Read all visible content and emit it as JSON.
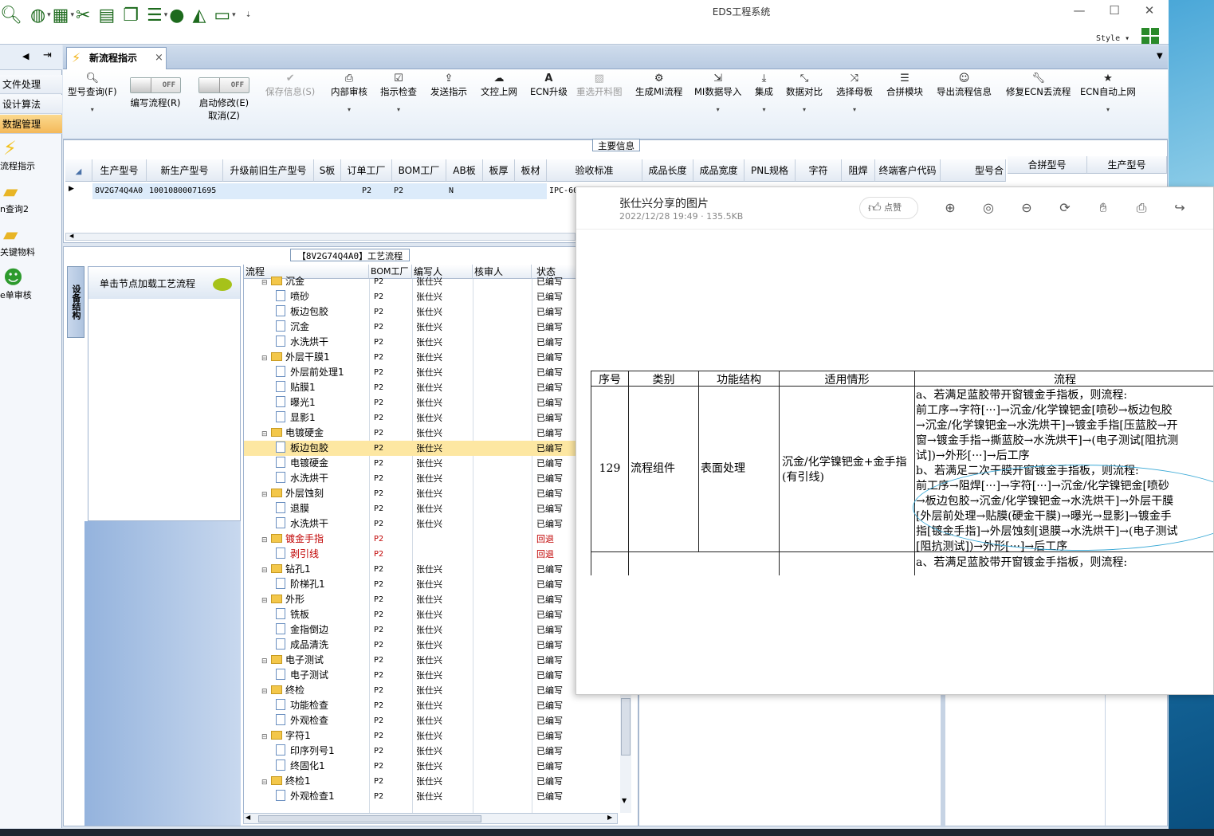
{
  "window": {
    "title": "EDS工程系统",
    "style_label": "Style",
    "controls": [
      "—",
      "☐",
      "✕"
    ]
  },
  "sidebar": {
    "items": [
      {
        "label": "文件处理"
      },
      {
        "label": "设计算法"
      },
      {
        "label": "数据管理"
      }
    ],
    "big_items": [
      {
        "label": "流程指示"
      },
      {
        "label": "n查询2"
      },
      {
        "label": "关键物料"
      },
      {
        "label": "e单审核"
      }
    ]
  },
  "tabs": {
    "active": "新流程指示",
    "close": "×"
  },
  "toolbar": {
    "items": [
      {
        "label": "型号查询(F)",
        "icon": "search-icon"
      },
      {
        "label": "编写流程(R)",
        "toggle": "OFF"
      },
      {
        "label": "启动修改(E)",
        "label2": "取消(Z)",
        "toggle": "OFF"
      },
      {
        "label": "保存信息(S)",
        "icon": "check-icon"
      },
      {
        "label": "内部审核",
        "icon": "printer-icon"
      },
      {
        "label": "指示检查",
        "icon": "checkbox-icon"
      },
      {
        "label": "发送指示",
        "icon": "upload-icon"
      },
      {
        "label": "文控上网",
        "icon": "cloud-icon"
      },
      {
        "label": "ECN升级",
        "icon": "font-icon"
      },
      {
        "label": "重选开料图",
        "icon": "image-icon"
      },
      {
        "label": "生成MI流程",
        "icon": "gears-icon"
      },
      {
        "label": "MI数据导入",
        "icon": "import-icon"
      },
      {
        "label": "集成",
        "icon": "download-icon"
      },
      {
        "label": "数据对比",
        "icon": "compress-icon"
      },
      {
        "label": "选择母板",
        "icon": "shuffle-icon"
      },
      {
        "label": "合拼模块",
        "icon": "list-icon"
      },
      {
        "label": "导出流程信息",
        "icon": "smile-icon"
      },
      {
        "label": "修复ECN丢流程",
        "icon": "wrench-icon"
      },
      {
        "label": "ECN自动上网",
        "icon": "star-icon"
      }
    ]
  },
  "main_info": {
    "title": "主要信息",
    "columns": [
      "生产型号",
      "新生产型号",
      "升级前旧生产型号",
      "S板",
      "订单工厂",
      "BOM工厂",
      "AB板",
      "板厚",
      "板材",
      "验收标准",
      "成品长度",
      "成品宽度",
      "PNL规格",
      "字符",
      "阻焊",
      "终端客户代码",
      "型号合",
      "合拼型号",
      "生产型号"
    ],
    "row": {
      "model": "8V2G74Q4A0",
      "new_model": "10010800071695",
      "order_factory": "P2",
      "bom_factory": "P2",
      "ab": "N",
      "standard": "IPC-60"
    }
  },
  "process": {
    "title": "【8V2G74Q4A0】工艺流程",
    "side_tab": "设备结构",
    "hint": "单击节点加载工艺流程",
    "columns": [
      "流程",
      "BOM工厂",
      "编写人",
      "核审人",
      "状态"
    ],
    "rows": [
      {
        "name": "沉金",
        "level": 0,
        "factory": "P2",
        "writer": "张仕兴",
        "status": "已编写"
      },
      {
        "name": "喷砂",
        "level": 1,
        "factory": "P2",
        "writer": "张仕兴",
        "status": "已编写"
      },
      {
        "name": "板边包胶",
        "level": 1,
        "factory": "P2",
        "writer": "张仕兴",
        "status": "已编写"
      },
      {
        "name": "沉金",
        "level": 1,
        "factory": "P2",
        "writer": "张仕兴",
        "status": "已编写"
      },
      {
        "name": "水洗烘干",
        "level": 1,
        "factory": "P2",
        "writer": "张仕兴",
        "status": "已编写"
      },
      {
        "name": "外层干膜1",
        "level": 0,
        "factory": "P2",
        "writer": "张仕兴",
        "status": "已编写"
      },
      {
        "name": "外层前处理1",
        "level": 1,
        "factory": "P2",
        "writer": "张仕兴",
        "status": "已编写"
      },
      {
        "name": "贴膜1",
        "level": 1,
        "factory": "P2",
        "writer": "张仕兴",
        "status": "已编写"
      },
      {
        "name": "曝光1",
        "level": 1,
        "factory": "P2",
        "writer": "张仕兴",
        "status": "已编写"
      },
      {
        "name": "显影1",
        "level": 1,
        "factory": "P2",
        "writer": "张仕兴",
        "status": "已编写"
      },
      {
        "name": "电镀硬金",
        "level": 0,
        "factory": "P2",
        "writer": "张仕兴",
        "status": "已编写"
      },
      {
        "name": "板边包胶",
        "level": 1,
        "factory": "P2",
        "writer": "张仕兴",
        "status": "已编写",
        "selected": true
      },
      {
        "name": "电镀硬金",
        "level": 1,
        "factory": "P2",
        "writer": "张仕兴",
        "status": "已编写"
      },
      {
        "name": "水洗烘干",
        "level": 1,
        "factory": "P2",
        "writer": "张仕兴",
        "status": "已编写"
      },
      {
        "name": "外层蚀刻",
        "level": 0,
        "factory": "P2",
        "writer": "张仕兴",
        "status": "已编写"
      },
      {
        "name": "退膜",
        "level": 1,
        "factory": "P2",
        "writer": "张仕兴",
        "status": "已编写"
      },
      {
        "name": "水洗烘干",
        "level": 1,
        "factory": "P2",
        "writer": "张仕兴",
        "status": "已编写"
      },
      {
        "name": "镀金手指",
        "level": 0,
        "factory": "P2",
        "writer": "",
        "status": "回退",
        "red": true
      },
      {
        "name": "剥引线",
        "level": 1,
        "factory": "P2",
        "writer": "",
        "status": "回退",
        "red": true
      },
      {
        "name": "钻孔1",
        "level": 0,
        "factory": "P2",
        "writer": "张仕兴",
        "status": "已编写"
      },
      {
        "name": "阶梯孔1",
        "level": 1,
        "factory": "P2",
        "writer": "张仕兴",
        "status": "已编写"
      },
      {
        "name": "外形",
        "level": 0,
        "factory": "P2",
        "writer": "张仕兴",
        "status": "已编写"
      },
      {
        "name": "铣板",
        "level": 1,
        "factory": "P2",
        "writer": "张仕兴",
        "status": "已编写"
      },
      {
        "name": "金指倒边",
        "level": 1,
        "factory": "P2",
        "writer": "张仕兴",
        "status": "已编写"
      },
      {
        "name": "成品清洗",
        "level": 1,
        "factory": "P2",
        "writer": "张仕兴",
        "status": "已编写"
      },
      {
        "name": "电子测试",
        "level": 0,
        "factory": "P2",
        "writer": "张仕兴",
        "status": "已编写"
      },
      {
        "name": "电子测试",
        "level": 1,
        "factory": "P2",
        "writer": "张仕兴",
        "status": "已编写"
      },
      {
        "name": "终检",
        "level": 0,
        "factory": "P2",
        "writer": "张仕兴",
        "status": "已编写"
      },
      {
        "name": "功能检查",
        "level": 1,
        "factory": "P2",
        "writer": "张仕兴",
        "status": "已编写"
      },
      {
        "name": "外观检查",
        "level": 1,
        "factory": "P2",
        "writer": "张仕兴",
        "status": "已编写"
      },
      {
        "name": "字符1",
        "level": 0,
        "factory": "P2",
        "writer": "张仕兴",
        "status": "已编写"
      },
      {
        "name": "印序列号1",
        "level": 1,
        "factory": "P2",
        "writer": "张仕兴",
        "status": "已编写"
      },
      {
        "name": "终固化1",
        "level": 1,
        "factory": "P2",
        "writer": "张仕兴",
        "status": "已编写"
      },
      {
        "name": "终检1",
        "level": 0,
        "factory": "P2",
        "writer": "张仕兴",
        "status": "已编写"
      },
      {
        "name": "外观检查1",
        "level": 1,
        "factory": "P2",
        "writer": "张仕兴",
        "status": "已编写"
      }
    ]
  },
  "viewer": {
    "title": "张仕兴分享的图片",
    "meta": "2022/12/28 19:49 · 135.5KB",
    "like": "点赞",
    "tools": [
      "zoom-in-icon",
      "fit-icon",
      "zoom-out-icon",
      "rotate-icon",
      "hand-icon",
      "print-icon",
      "share-icon"
    ],
    "doc": {
      "headers": [
        "序号",
        "类别",
        "功能结构",
        "适用情形",
        "流程"
      ],
      "no": "129",
      "category": "流程组件",
      "function": "表面处理",
      "scenario": "沉金/化学镍钯金+金手指(有引线)",
      "lines": [
        "a、若满足蓝胶带开窗镀金手指板，则流程:",
        "前工序→字符[···]→沉金/化学镍钯金[喷砂→板边包胶",
        "→沉金/化学镍钯金→水洗烘干]→镀金手指[压蓝胶→开",
        "窗→镀金手指→撕蓝胶→水洗烘干]→(电子测试[阻抗测",
        "试])→外形[···]→后工序",
        "b、若满足二次干膜开窗镀金手指板，则流程:",
        "前工序→阻焊[···]→字符[···]→沉金/化学镍钯金[喷砂",
        "→板边包胶→沉金/化学镍钯金→水洗烘干]→外层干膜",
        "[外层前处理→贴膜(硬金干膜)→曝光→显影]→镀金手",
        "指[镀金手指]→外层蚀刻[退膜→水洗烘干]→(电子测试",
        "[阻抗测试])→外形[···]→后工序",
        "a、若满足蓝胶带开窗镀金手指板，则流程:"
      ]
    }
  }
}
